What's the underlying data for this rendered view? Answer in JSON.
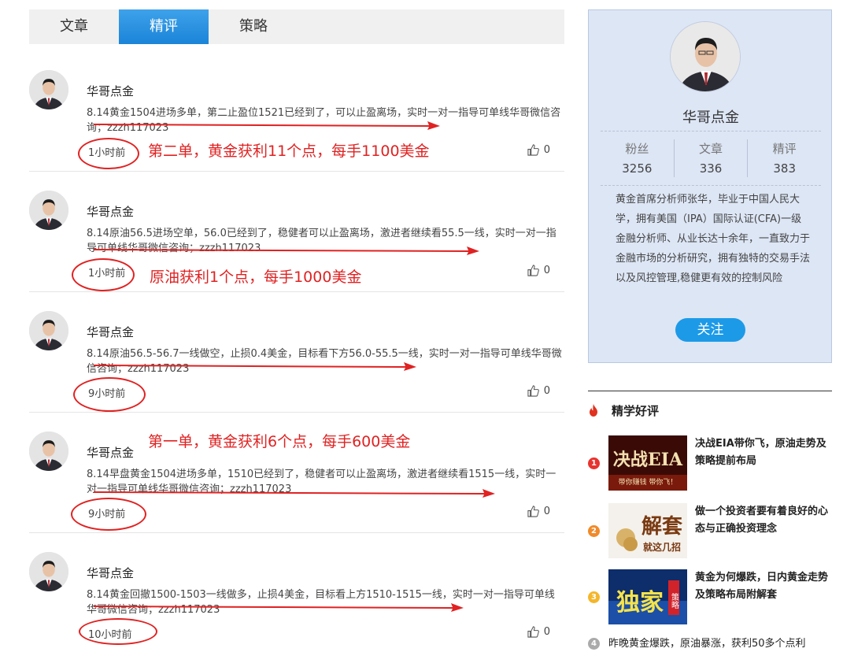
{
  "tabs": [
    {
      "label": "文章"
    },
    {
      "label": "精评",
      "active": true
    },
    {
      "label": "策略"
    }
  ],
  "colors": {
    "accent": "#1b84d8",
    "annotation": "#e02222",
    "card_bg": "#dde6f5"
  },
  "posts": [
    {
      "author": "华哥点金",
      "content": "8.14黄金1504进场多单，第二止盈位1521已经到了，可以止盈离场，实时一对一指导可单线华哥微信咨询；zzzh117023",
      "time": "1小时前",
      "likes": "0",
      "annotation": "第二单，黄金获利11个点，每手1100美金"
    },
    {
      "author": "华哥点金",
      "content": "8.14原油56.5进场空单，56.0已经到了，稳健者可以止盈离场，激进者继续看55.5一线，实时一对一指导可单线华哥微信咨询；zzzh117023",
      "time": "1小时前",
      "likes": "0",
      "annotation": "原油获利1个点，每手1000美金"
    },
    {
      "author": "华哥点金",
      "content": "8.14原油56.5-56.7一线做空，止损0.4美金，目标看下方56.0-55.5一线，实时一对一指导可单线华哥微信咨询；zzzh117023",
      "time": "9小时前",
      "likes": "0",
      "annotation": ""
    },
    {
      "author": "华哥点金",
      "content": "8.14早盘黄金1504进场多单，1510已经到了，稳健者可以止盈离场，激进者继续看1515一线，实时一对一指导可单线华哥微信咨询；zzzh117023",
      "time": "9小时前",
      "likes": "0",
      "annotation": "第一单，黄金获利6个点，每手600美金"
    },
    {
      "author": "华哥点金",
      "content": "8.14黄金回撤1500-1503一线做多，止损4美金，目标看上方1510-1515一线，实时一对一指导可单线华哥微信咨询；zzzh117023",
      "time": "10小时前",
      "likes": "0",
      "annotation": ""
    }
  ],
  "profile": {
    "name": "华哥点金",
    "stats": [
      {
        "label": "粉丝",
        "value": "3256"
      },
      {
        "label": "文章",
        "value": "336"
      },
      {
        "label": "精评",
        "value": "383"
      }
    ],
    "bio": "黄金首席分析师张华，毕业于中国人民大学，拥有美国（IPA）国际认证(CFA)一级金融分析师、从业长达十余年，一直致力于金融市场的分析研究，拥有独特的交易手法以及风控管理,稳健更有效的控制风险",
    "follow_label": "关注"
  },
  "recommended": {
    "title": "精学好评",
    "items": [
      {
        "num": "1",
        "color": "#e8332f",
        "text": "决战EIA带你飞，原油走势及策略提前布局",
        "thumb_text": "决战EIA",
        "thumb_sub": "带你赚钱  带你飞！"
      },
      {
        "num": "2",
        "color": "#f08a2a",
        "text": "做一个投资者要有着良好的心态与正确投资理念",
        "thumb_text": "解套",
        "thumb_sub": "就这几招"
      },
      {
        "num": "3",
        "color": "#f4b62a",
        "text": "黄金为何爆跌，日内黄金走势及策略布局附解套",
        "thumb_text": "独家",
        "thumb_sub": "策略"
      }
    ],
    "last": {
      "num": "4",
      "text": "昨晚黄金爆跌，原油暴涨，获利50多个点利"
    }
  }
}
